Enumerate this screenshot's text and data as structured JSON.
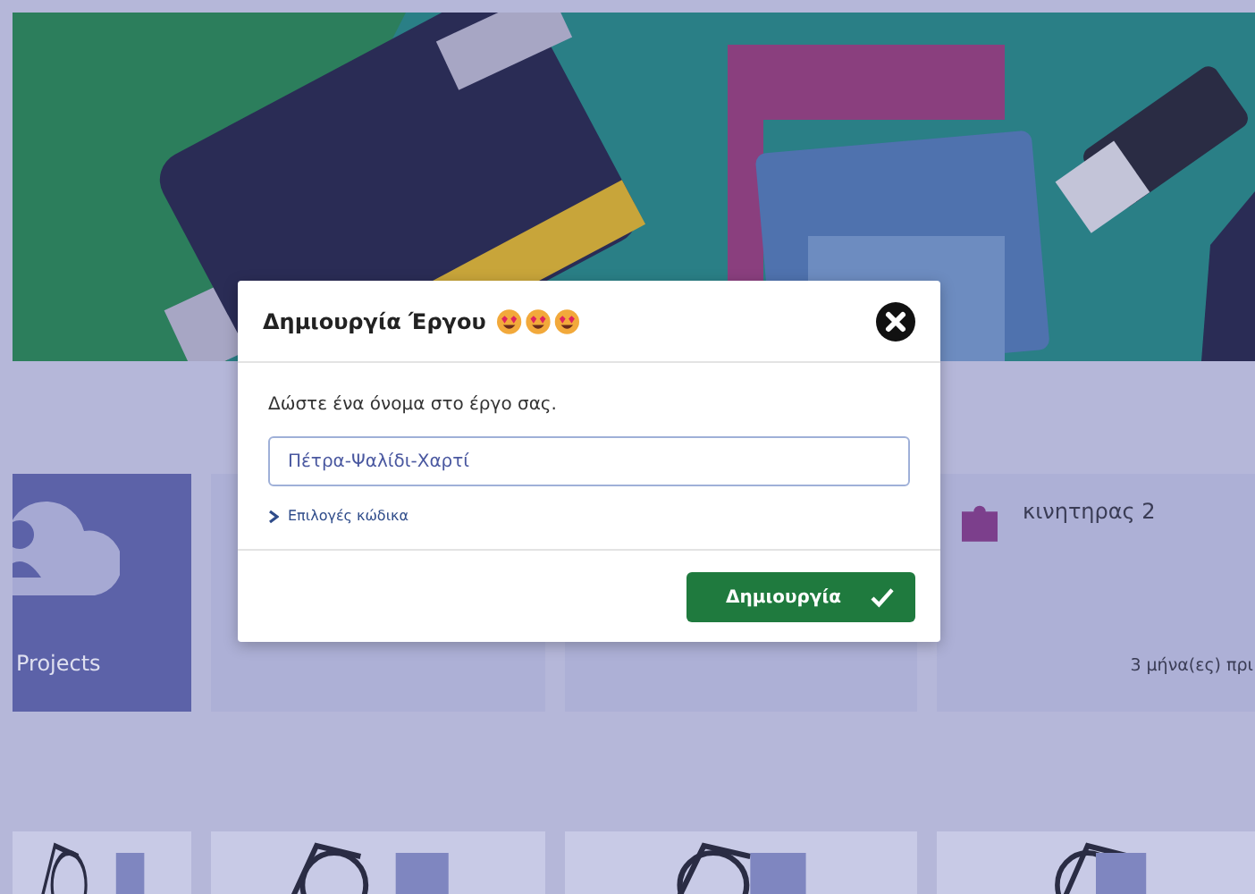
{
  "projects": [
    {
      "kind": "my-projects",
      "label": "Projects"
    },
    {
      "kind": "project"
    },
    {
      "kind": "project"
    },
    {
      "kind": "project",
      "name": "κινητηρας 2",
      "date": "3 μήνα(ες) πρι"
    }
  ],
  "dialog": {
    "title": "Δημιουργία Έργου",
    "prompt": "Δώστε ένα όνομα στο έργο σας.",
    "name_field": {
      "value": "Πέτρα-Ψαλίδι-Χαρτί"
    },
    "code_options": {
      "label": "Επιλογές κώδικα",
      "expanded": false
    },
    "create_button": "Δημιουργία"
  }
}
